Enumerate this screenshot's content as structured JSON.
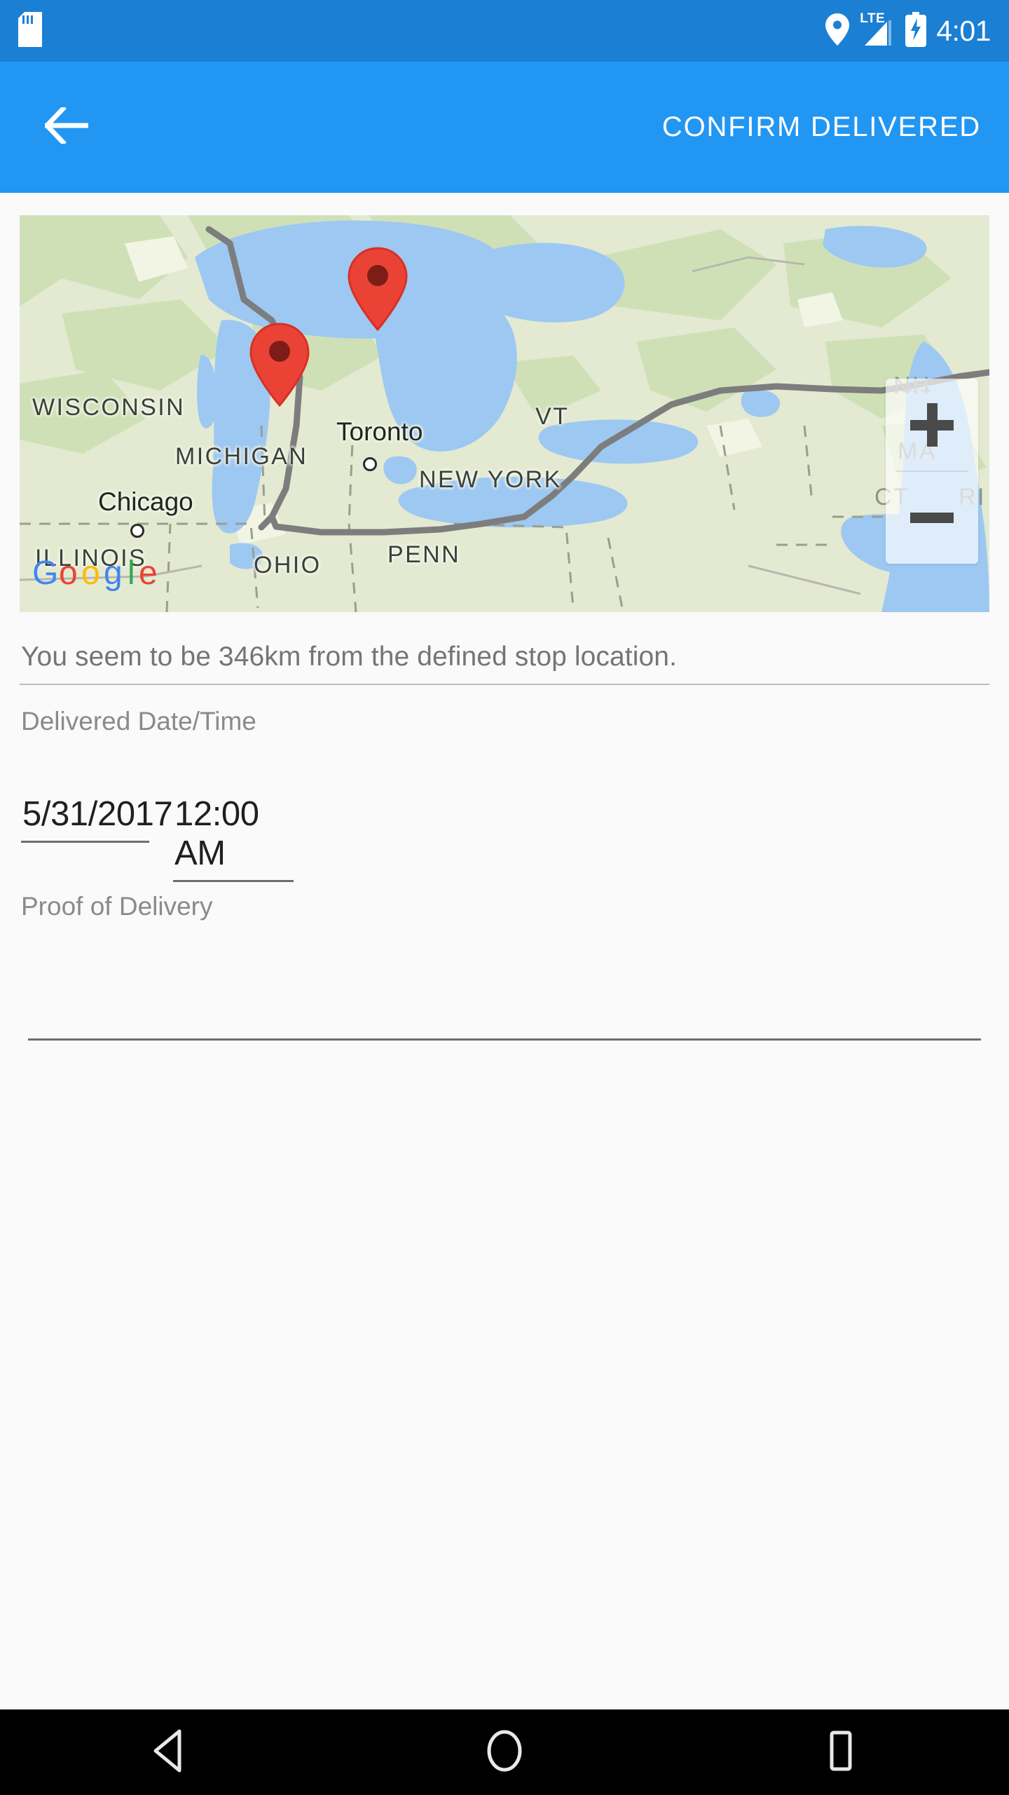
{
  "statusbar": {
    "sd_icon": "sd-card-icon",
    "location_icon": "location-pin-icon",
    "network_label": "LTE",
    "signal_icon": "signal-bars-icon",
    "battery_icon": "battery-charging-icon",
    "time": "4:01"
  },
  "appbar": {
    "back_icon": "arrow-back-icon",
    "title": "CONFIRM DELIVERED",
    "background": "#2196f3"
  },
  "map": {
    "provider_logo": "google-logo",
    "provider_name": "Google",
    "zoom_in_label": "+",
    "zoom_out_label": "−",
    "markers": [
      {
        "name": "stop-marker-toronto",
        "color": "#ea4335"
      },
      {
        "name": "current-location-marker-michigan",
        "color": "#ea4335"
      }
    ],
    "labels": [
      {
        "text": "WISCONSIN",
        "kind": "state"
      },
      {
        "text": "MICHIGAN",
        "kind": "state"
      },
      {
        "text": "Chicago",
        "kind": "city"
      },
      {
        "text": "Toronto",
        "kind": "city"
      },
      {
        "text": "NEW YORK",
        "kind": "state"
      },
      {
        "text": "ILLINOIS",
        "kind": "state"
      },
      {
        "text": "OHIO",
        "kind": "state"
      },
      {
        "text": "PENN",
        "kind": "state"
      },
      {
        "text": "VT",
        "kind": "state"
      },
      {
        "text": "NH",
        "kind": "state"
      },
      {
        "text": "MA",
        "kind": "state"
      },
      {
        "text": "CT",
        "kind": "state"
      },
      {
        "text": "RI",
        "kind": "state"
      }
    ]
  },
  "form": {
    "distance_message": "You seem to be 346km from the defined stop location.",
    "datetime_label": "Delivered Date/Time",
    "date_value": "5/31/2017",
    "time_value": "12:00 AM",
    "proof_label": "Proof of Delivery",
    "proof_value": "",
    "proof_placeholder": ""
  },
  "navbar": {
    "back_icon": "nav-back-triangle-icon",
    "home_icon": "nav-home-circle-icon",
    "recents_icon": "nav-recents-square-icon"
  },
  "colors": {
    "status_bar": "#1b7fd4",
    "app_bar": "#2196f3",
    "page_bg": "#fafafa",
    "marker": "#ea4335",
    "muted_text": "#8a8a8a"
  }
}
